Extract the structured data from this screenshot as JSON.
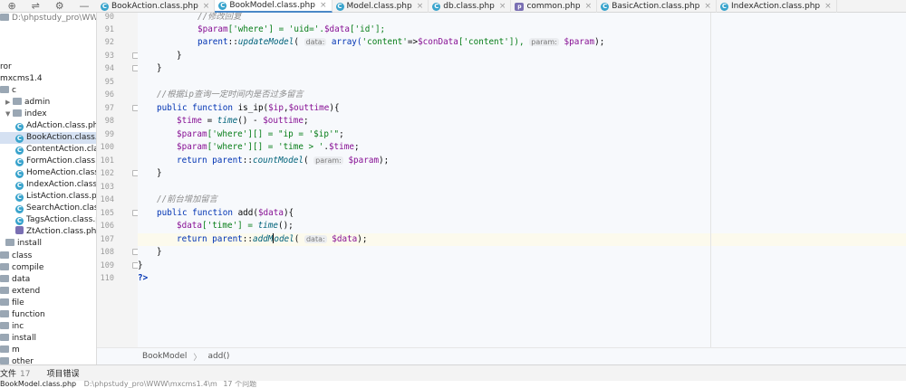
{
  "toolbar": {
    "icons": [
      "globe-icon",
      "collapse-icon",
      "settings-icon",
      "minimize-icon"
    ],
    "glyphs": [
      "⊕",
      "⇌",
      "⚙",
      "—"
    ]
  },
  "tabs": [
    {
      "label": "BookAction.class.php",
      "active": false
    },
    {
      "label": "BookModel.class.php",
      "active": true
    },
    {
      "label": "Model.class.php",
      "active": false
    },
    {
      "label": "db.class.php",
      "active": false
    },
    {
      "label": "common.php",
      "active": false
    },
    {
      "label": "BasicAction.class.php",
      "active": false
    },
    {
      "label": "IndexAction.class.php",
      "active": false
    }
  ],
  "tree": {
    "root_path": "D:\\phpstudy_pro\\WWW",
    "items": [
      {
        "label": "ror"
      },
      {
        "label": "mxcms1.4"
      },
      {
        "label": "c"
      },
      {
        "label": "admin"
      },
      {
        "label": "index"
      },
      {
        "label": "AdAction.class.php"
      },
      {
        "label": "BookAction.class.php"
      },
      {
        "label": "ContentAction.class.php"
      },
      {
        "label": "FormAction.class.php"
      },
      {
        "label": "HomeAction.class.php"
      },
      {
        "label": "IndexAction.class.php"
      },
      {
        "label": "ListAction.class.php"
      },
      {
        "label": "SearchAction.class.php"
      },
      {
        "label": "TagsAction.class.php"
      },
      {
        "label": "ZtAction.class.php"
      },
      {
        "label": "install"
      },
      {
        "label": "class"
      },
      {
        "label": "compile"
      },
      {
        "label": "data"
      },
      {
        "label": "extend"
      },
      {
        "label": "file"
      },
      {
        "label": "function"
      },
      {
        "label": "inc"
      },
      {
        "label": "install"
      },
      {
        "label": "m"
      },
      {
        "label": "other"
      }
    ]
  },
  "editor": {
    "line_numbers": [
      "90",
      "91",
      "92",
      "93",
      "94",
      "95",
      "96",
      "97",
      "98",
      "99",
      "100",
      "101",
      "102",
      "103",
      "104",
      "105",
      "106",
      "107",
      "108",
      "109",
      "110"
    ],
    "code": {
      "l90": "//修改回复",
      "l91a": "$param",
      "l91b": "['where'] = 'uid='.",
      "l91c": "$data",
      "l91d": "['id'];",
      "l92a": "parent",
      "l92b": "::",
      "l92c": "updateModel",
      "l92d": "(",
      "l92h1": "data:",
      "l92e": " array(",
      "l92f": "'content'",
      "l92g": "=>",
      "l92v": "$conData",
      "l92i": "['content']),",
      "l92h2": "param:",
      "l92j": "$param",
      "l92k": ");",
      "l93": "}",
      "l94": "}",
      "l96": "//根据ip查询一定时间内是否过多留言",
      "l97a": "public function ",
      "l97b": "is_ip(",
      "l97c": "$ip",
      "l97d": ",",
      "l97e": "$outtime",
      "l97f": "){",
      "l98a": "$time",
      "l98b": " = ",
      "l98c": "time",
      "l98d": "() - ",
      "l98e": "$outtime",
      "l98f": ";",
      "l99a": "$param",
      "l99b": "['where'][] = ",
      "l99c": "\"ip = '$ip'\"",
      "l99d": ";",
      "l100a": "$param",
      "l100b": "['where'][] = ",
      "l100c": "'time > '",
      "l100d": ".",
      "l100e": "$time",
      "l100f": ";",
      "l101a": "return parent",
      "l101b": "::",
      "l101c": "countModel",
      "l101d": "(",
      "l101h": "param:",
      "l101e": "$param",
      "l101f": ");",
      "l102": "}",
      "l104": "//前台增加留言",
      "l105a": "public function ",
      "l105b": "add(",
      "l105c": "$data",
      "l105d": "){",
      "l106a": "$data",
      "l106b": "['time'] = ",
      "l106c": "time",
      "l106d": "();",
      "l107a": "return parent",
      "l107b": "::",
      "l107c": "addM",
      "l107c2": "odel",
      "l107d": "(",
      "l107h": "data:",
      "l107e": "$data",
      "l107f": ");",
      "l108": "}",
      "l109": "}",
      "l110": "?>"
    }
  },
  "breadcrumb": {
    "class_name": "BookModel",
    "method": "add()",
    "separator": "〉"
  },
  "bottom": {
    "tab1_label": "文件",
    "tab1_count": "17",
    "tab2_label": "项目错误",
    "file_label": "BookModel.class.php",
    "file_path": "D:\\phpstudy_pro\\WWW\\mxcms1.4\\m",
    "file_count": "17 个问题"
  },
  "colors": {
    "accent": "#4a88c7",
    "keyword": "#0033b3",
    "variable": "#871094",
    "string": "#067d17",
    "comment": "#8c8c8c"
  }
}
